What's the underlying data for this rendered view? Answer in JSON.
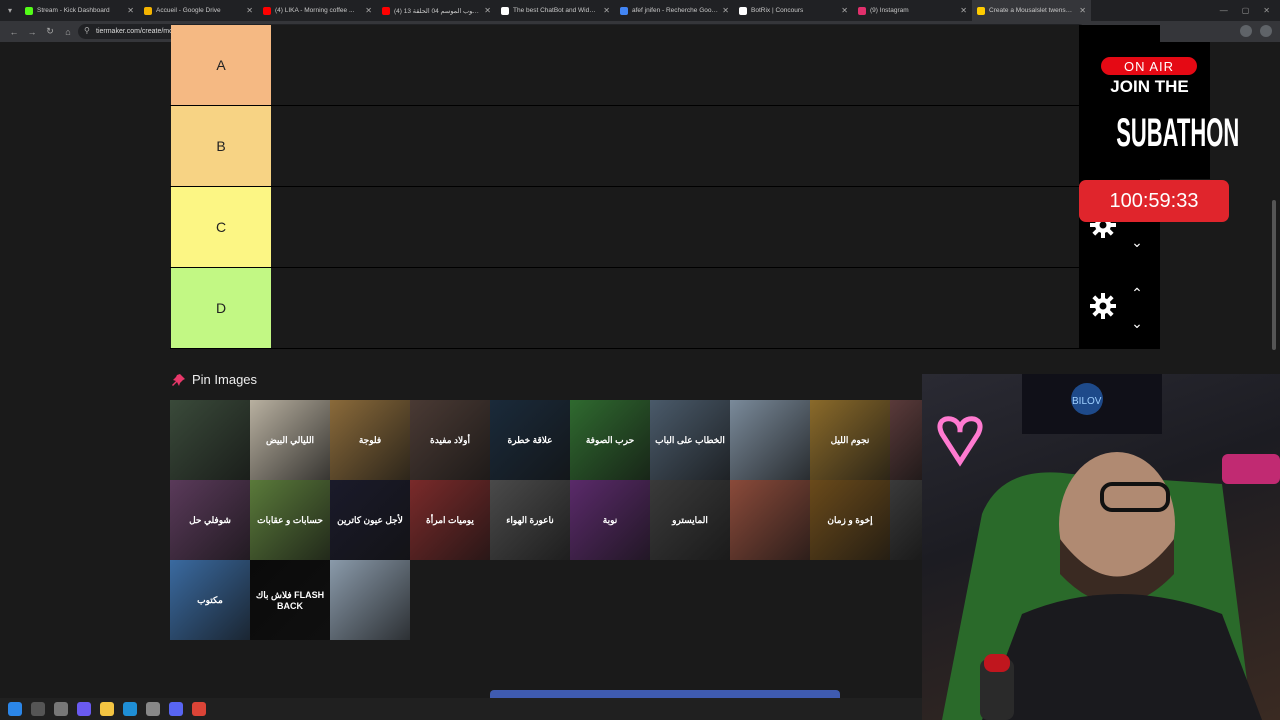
{
  "browser": {
    "tabs": [
      {
        "title": "Stream - Kick Dashboard",
        "color": "#53fc18"
      },
      {
        "title": "Accueil - Google Drive",
        "color": "#f4b400"
      },
      {
        "title": "(4) LIKA - Morning coffee ...",
        "color": "#ff0000"
      },
      {
        "title": "(4) مكتوب الموسم 04 الحلقة 13",
        "color": "#ff0000"
      },
      {
        "title": "The best ChatBot and Widget...",
        "color": "#ffffff"
      },
      {
        "title": "afef jnifen - Recherche Google",
        "color": "#4285f4"
      },
      {
        "title": "BotRix | Concours",
        "color": "#ffffff"
      },
      {
        "title": "(9) Instagram",
        "color": "#e1306c"
      },
      {
        "title": "Create a Mousalslet twensa T...",
        "color": "#ffcc00"
      }
    ],
    "url": "tiermaker.com/create/mousalslet-twenssa-18636250?hide=true"
  },
  "tiers": [
    {
      "label": "A",
      "color": "#f5b983"
    },
    {
      "label": "B",
      "color": "#f7d384"
    },
    {
      "label": "C",
      "color": "#fcf684"
    },
    {
      "label": "D",
      "color": "#c2f884"
    }
  ],
  "pin": {
    "title": "Pin Images"
  },
  "thumbnails": [
    {
      "text": "",
      "bg": "#3a4a3a"
    },
    {
      "text": "الليالي البيض",
      "bg": "#b8b0a0"
    },
    {
      "text": "فلوجة",
      "bg": "#8a6a3a"
    },
    {
      "text": "أولاد مفيدة",
      "bg": "#4a3a34"
    },
    {
      "text": "علاقة خطرة",
      "bg": "#1a2a3a"
    },
    {
      "text": "حرب الصوفة",
      "bg": "#2f6a2f"
    },
    {
      "text": "الخطاب على الباب",
      "bg": "#4a5a6a"
    },
    {
      "text": "",
      "bg": "#7a8a9a"
    },
    {
      "text": "نجوم الليل",
      "bg": "#8a6a2a"
    },
    {
      "text": "",
      "bg": "#5a3a3a"
    },
    {
      "text": "شوفلي حل",
      "bg": "#5a3a5a"
    },
    {
      "text": "حسابات و عقابات",
      "bg": "#5a7a3a"
    },
    {
      "text": "لأجل عيون كاترين",
      "bg": "#1a1a2a"
    },
    {
      "text": "يوميات امرأة",
      "bg": "#7a2a2a"
    },
    {
      "text": "ناعورة الهواء",
      "bg": "#4a4a4a"
    },
    {
      "text": "نوبة",
      "bg": "#5a2a6a"
    },
    {
      "text": "المايسترو",
      "bg": "#3a3a3a"
    },
    {
      "text": "",
      "bg": "#8a4a3a"
    },
    {
      "text": "إخوة و زمان",
      "bg": "#6a4a1a"
    },
    {
      "text": "",
      "bg": "#3a3a3a"
    },
    {
      "text": "مكتوب",
      "bg": "#3a6aa0"
    },
    {
      "text": "فلاش باك FLASH BACK",
      "bg": "#0a0a0a"
    },
    {
      "text": "",
      "bg": "#8a9aaa"
    }
  ],
  "overlay": {
    "on_air": "ON AIR",
    "join": "JOIN THE",
    "subathon": "SUBATHON",
    "timer": "100:59:33"
  },
  "colors": {
    "accent": "#e0252c",
    "page_bg": "#1a1a1a"
  }
}
